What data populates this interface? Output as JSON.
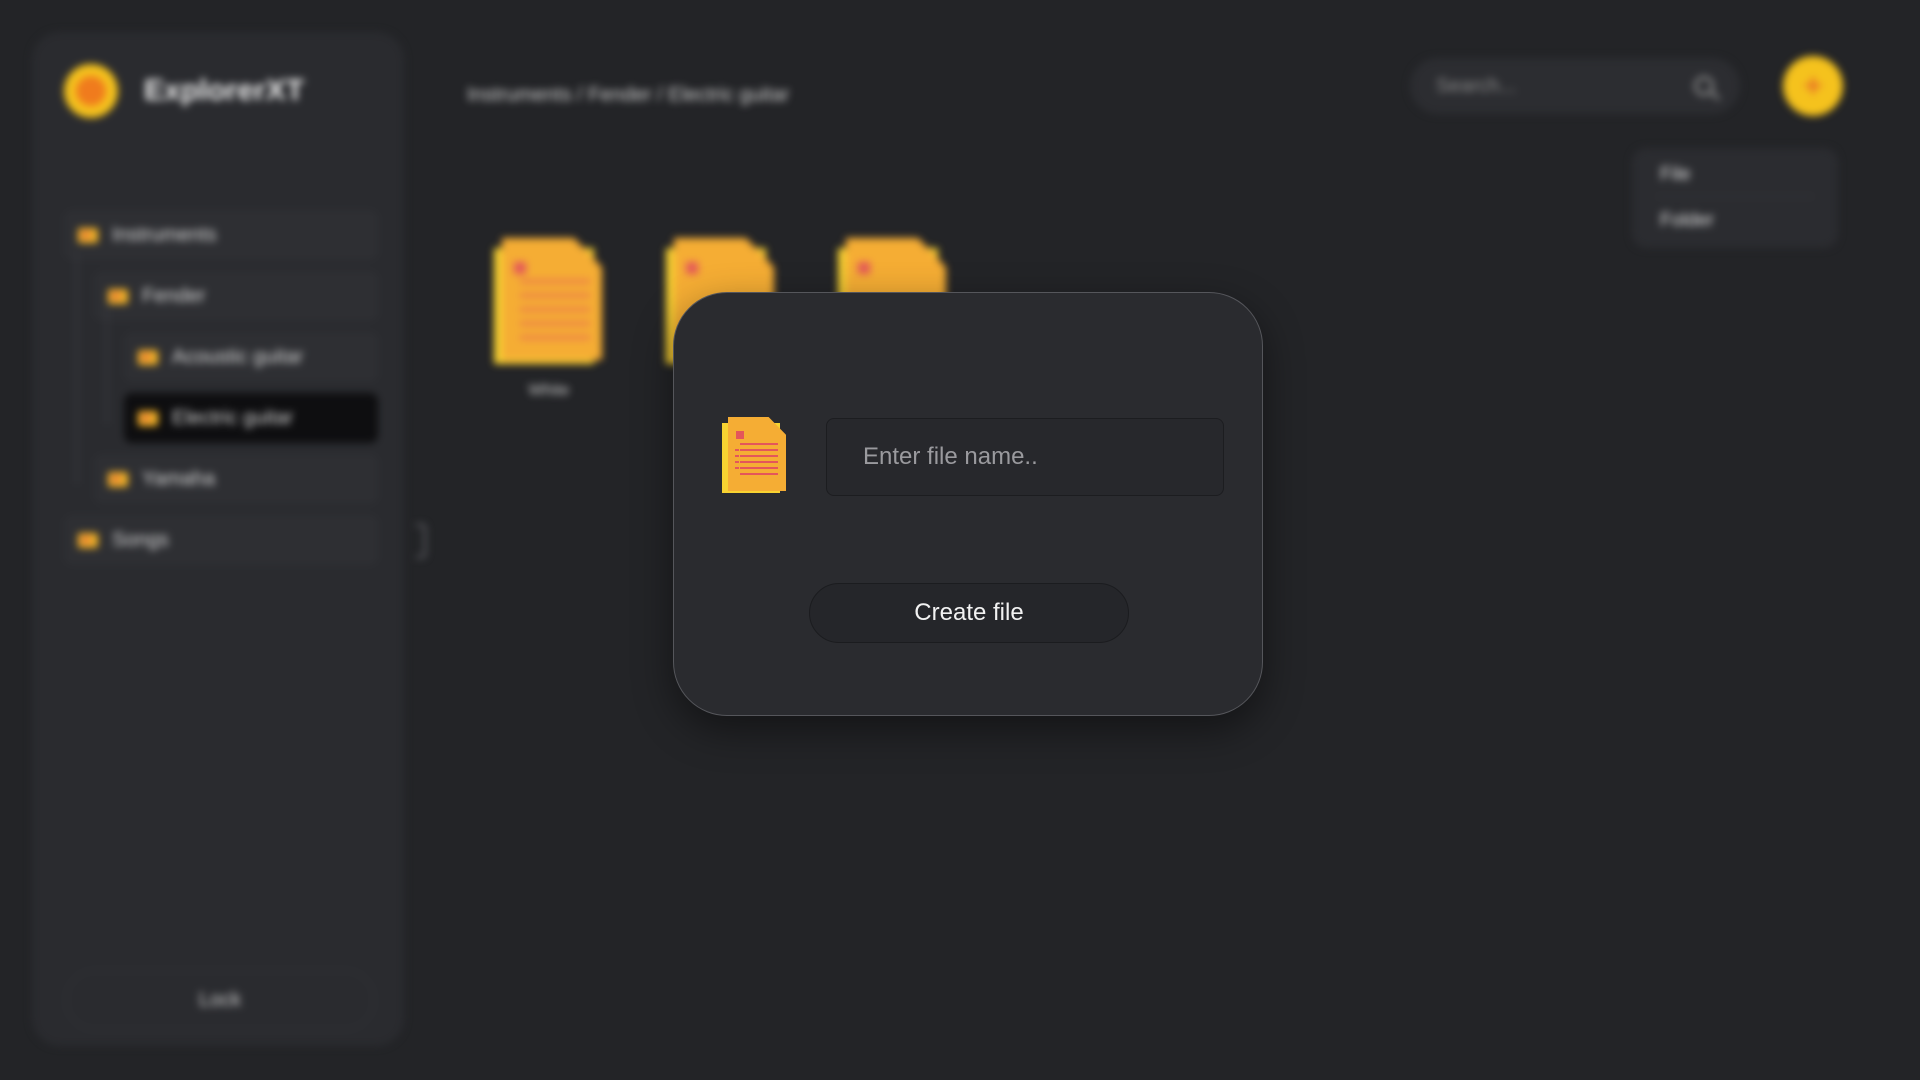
{
  "app": {
    "name": "ExplorerXT"
  },
  "sidebar": {
    "tree": [
      {
        "label": "Instruments",
        "level": 0
      },
      {
        "label": "Fender",
        "level": 1
      },
      {
        "label": "Acoustic guitar",
        "level": 2
      },
      {
        "label": "Electric guitar",
        "level": 2,
        "active": true
      },
      {
        "label": "Yamaha",
        "level": 1
      },
      {
        "label": "Songs",
        "level": 0
      }
    ],
    "lock_label": "Lock"
  },
  "header": {
    "breadcrumb": "Instruments / Fender / Electric guitar",
    "search_placeholder": "Search...",
    "add_label": "+"
  },
  "add_menu": {
    "items": [
      "File",
      "Folder"
    ]
  },
  "files": [
    {
      "label": "White"
    },
    {
      "label": ""
    },
    {
      "label": ""
    }
  ],
  "modal": {
    "input_placeholder": "Enter file name..",
    "input_value": "",
    "create_label": "Create file"
  },
  "colors": {
    "accent": "#f5c21d",
    "background": "#232427",
    "panel": "#2a2b2f"
  }
}
